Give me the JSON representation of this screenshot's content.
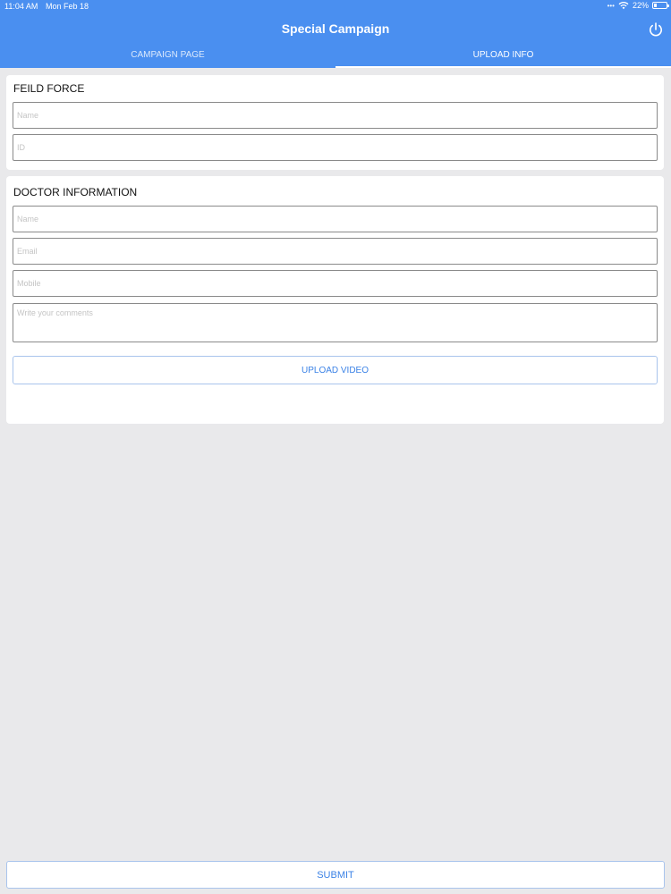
{
  "status_bar": {
    "time": "11:04 AM",
    "date": "Mon Feb 18",
    "signal": "•••",
    "battery": "22%",
    "icons": [
      "wifi-icon",
      "battery-icon"
    ]
  },
  "header": {
    "title": "Special Campaign",
    "power_icon": "power-icon",
    "tabs": [
      {
        "label": "CAMPAIGN PAGE",
        "active": false
      },
      {
        "label": "UPLOAD INFO",
        "active": true
      }
    ]
  },
  "field_force": {
    "title": "FEILD FORCE",
    "name_placeholder": "Name",
    "name_value": "",
    "id_placeholder": "ID",
    "id_value": ""
  },
  "doctor": {
    "title": "DOCTOR INFORMATION",
    "name_placeholder": "Name",
    "name_value": "",
    "email_placeholder": "Email",
    "email_value": "",
    "mobile_placeholder": "Mobile",
    "mobile_value": "",
    "comments_placeholder": "Write your comments",
    "comments_value": "",
    "upload_label": "UPLOAD VIDEO"
  },
  "submit_label": "SUBMIT",
  "colors": {
    "header": "#4a8ff0",
    "accent": "#3b82e6",
    "background": "#e9e9eb"
  }
}
